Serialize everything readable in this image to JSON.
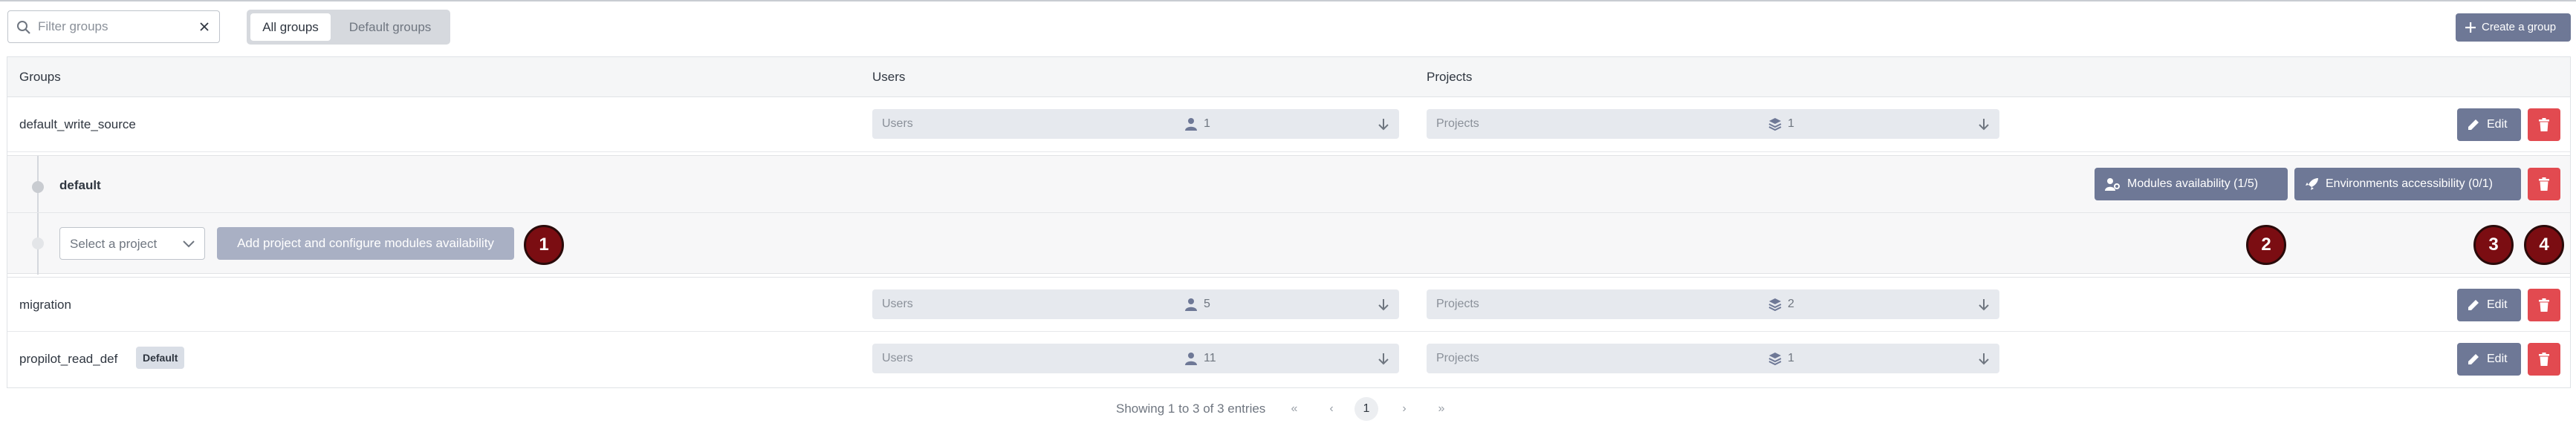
{
  "toolbar": {
    "search_placeholder": "Filter groups",
    "tabs": [
      {
        "label": "All groups",
        "active": true
      },
      {
        "label": "Default groups",
        "active": false
      }
    ],
    "create_label": "Create a group"
  },
  "table": {
    "headers": {
      "groups": "Groups",
      "users": "Users",
      "projects": "Projects"
    },
    "rows": [
      {
        "name": "default_write_source",
        "users_label": "Users",
        "users_count": "1",
        "projects_label": "Projects",
        "projects_count": "1",
        "badge": ""
      },
      {
        "name": "migration",
        "users_label": "Users",
        "users_count": "5",
        "projects_label": "Projects",
        "projects_count": "2",
        "badge": ""
      },
      {
        "name": "propilot_read_def",
        "users_label": "Users",
        "users_count": "11",
        "projects_label": "Projects",
        "projects_count": "1",
        "badge": "Default"
      }
    ],
    "edit_label": "Edit"
  },
  "subgroup": {
    "title": "default",
    "modules_label": "Modules availability (1/5)",
    "environments_label": "Environments accessibility (0/1)",
    "select_placeholder": "Select a project",
    "add_label": "Add project and configure modules availability"
  },
  "markers": [
    "1",
    "2",
    "3",
    "4"
  ],
  "pagination": {
    "info": "Showing 1 to 3 of 3 entries",
    "first": "«",
    "prev": "‹",
    "current": "1",
    "next": "›",
    "last": "»"
  },
  "colors": {
    "primary": "#6e7896",
    "danger": "#e24a50",
    "marker": "#7b0d12"
  }
}
